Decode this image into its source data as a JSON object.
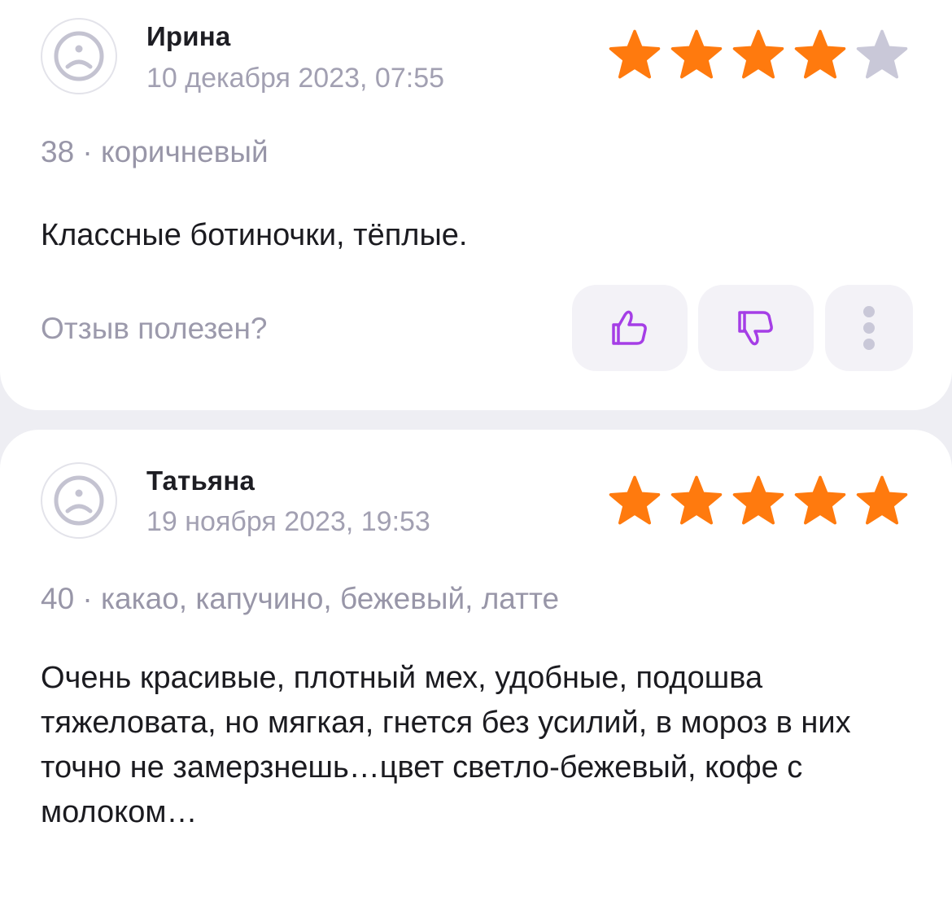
{
  "colors": {
    "star_filled": "#ff7a0e",
    "star_empty": "#c9c8d8",
    "accent_purple": "#a53ee6",
    "avatar_gray": "#c4c3d1"
  },
  "reviews": [
    {
      "author": "Ирина",
      "date": "10 декабря 2023, 07:55",
      "rating": 4,
      "rating_max": 5,
      "variant": "38 · коричневый",
      "text": "Классные ботиночки, тёплые.",
      "helpful_label": "Отзыв полезен?",
      "icons": {
        "avatar": "sad-face-icon",
        "like": "thumbs-up-icon",
        "dislike": "thumbs-down-icon",
        "more": "more-vertical-icon"
      }
    },
    {
      "author": "Татьяна",
      "date": "19 ноября 2023, 19:53",
      "rating": 5,
      "rating_max": 5,
      "variant": "40 · какао, капучино, бежевый, латте",
      "text": "Очень красивые, плотный мех, удобные, подошва тяжеловата, но мягкая, гнется без усилий, в мороз в них точно не замерзнешь…цвет светло-бежевый, кофе с молоком…",
      "icons": {
        "avatar": "sad-face-icon"
      }
    }
  ]
}
